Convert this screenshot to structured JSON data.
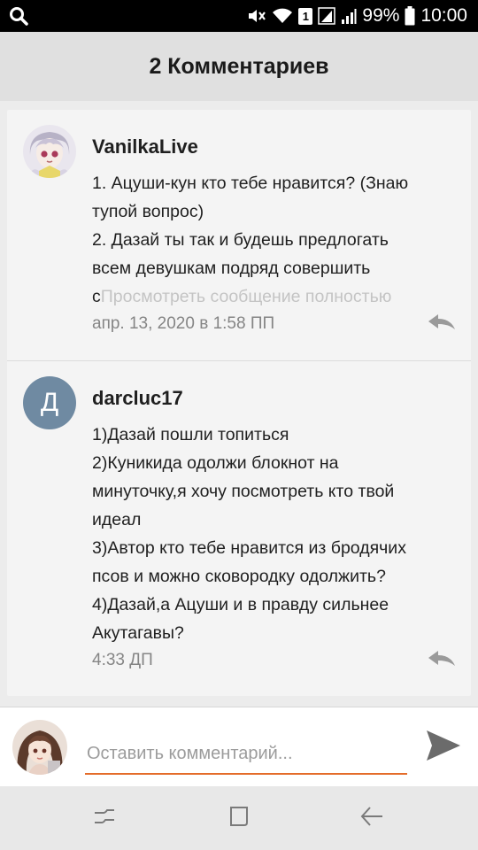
{
  "status_bar": {
    "battery_percent": "99%",
    "time": "10:00",
    "sim_slot": "1"
  },
  "header": {
    "title": "2 Комментариев"
  },
  "comments": [
    {
      "author": "VanilkaLive",
      "avatar_type": "image",
      "lines": [
        "1. Ацуши-кун кто тебе нравится? (Знаю",
        "тупой вопрос)",
        "2. Дазай ты так и будешь предлогать",
        "всем девушкам подряд совершить"
      ],
      "last_line_start": "с",
      "view_full_label": "Просмотреть сообщение полностью",
      "timestamp": "апр. 13, 2020 в 1:58 ПП",
      "reply_icon": "reply-arrow-icon"
    },
    {
      "author": "darcluc17",
      "avatar_type": "letter",
      "avatar_letter": "Д",
      "avatar_color": "#6f8aa2",
      "lines": [
        "1)Дазай пошли топиться",
        "2)Куникида одолжи блокнот на",
        "минуточку,я хочу посмотреть кто твой",
        "идеал",
        "3)Автор кто тебе нравится из бродячих",
        "псов и можно сковородку одолжить?",
        "4)Дазай,а Ацуши и в правду сильнее",
        "Акутагавы?"
      ],
      "timestamp": "4:33 ДП",
      "reply_icon": "reply-arrow-icon"
    }
  ],
  "comment_input": {
    "placeholder": "Оставить комментарий...",
    "value": ""
  },
  "colors": {
    "accent": "#e46c2a",
    "header_bg": "#e0e0e0",
    "card_bg": "#f4f4f4",
    "send_icon": "#6b6b6b"
  },
  "icons": {
    "status_left": "search-icon",
    "send": "send-icon",
    "nav": [
      "recent-apps-icon",
      "home-icon",
      "back-icon"
    ]
  }
}
